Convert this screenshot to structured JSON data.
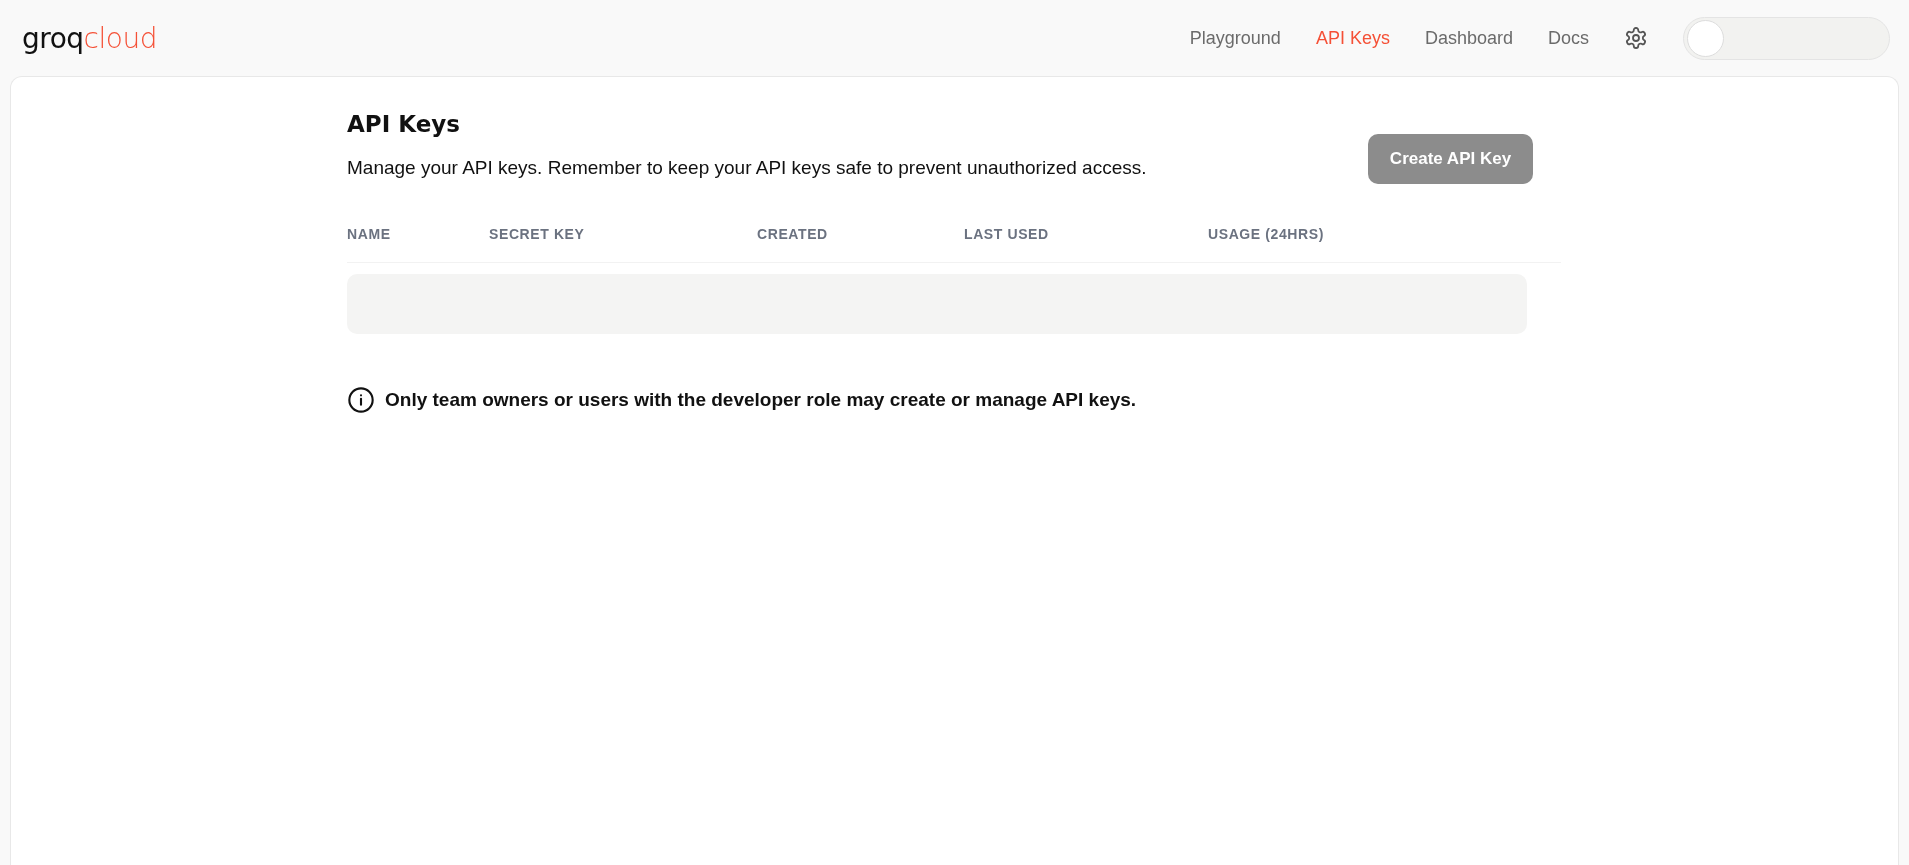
{
  "header": {
    "logo": {
      "main": "groq",
      "accent": "cloud"
    },
    "nav": [
      {
        "label": "Playground",
        "selected": false
      },
      {
        "label": "API Keys",
        "selected": true
      },
      {
        "label": "Dashboard",
        "selected": false
      },
      {
        "label": "Docs",
        "selected": false
      }
    ],
    "theme_toggle": {
      "on": false
    }
  },
  "page": {
    "title": "API Keys",
    "description": "Manage your API keys. Remember to keep your API keys safe to prevent unauthorized access.",
    "create_button": {
      "label": "Create API Key",
      "disabled": true
    },
    "table": {
      "columns": [
        "NAME",
        "SECRET KEY",
        "CREATED",
        "LAST USED",
        "USAGE (24HRS)"
      ],
      "loading": true
    },
    "notice": "Only team owners or users with the developer role may create or manage API keys."
  }
}
